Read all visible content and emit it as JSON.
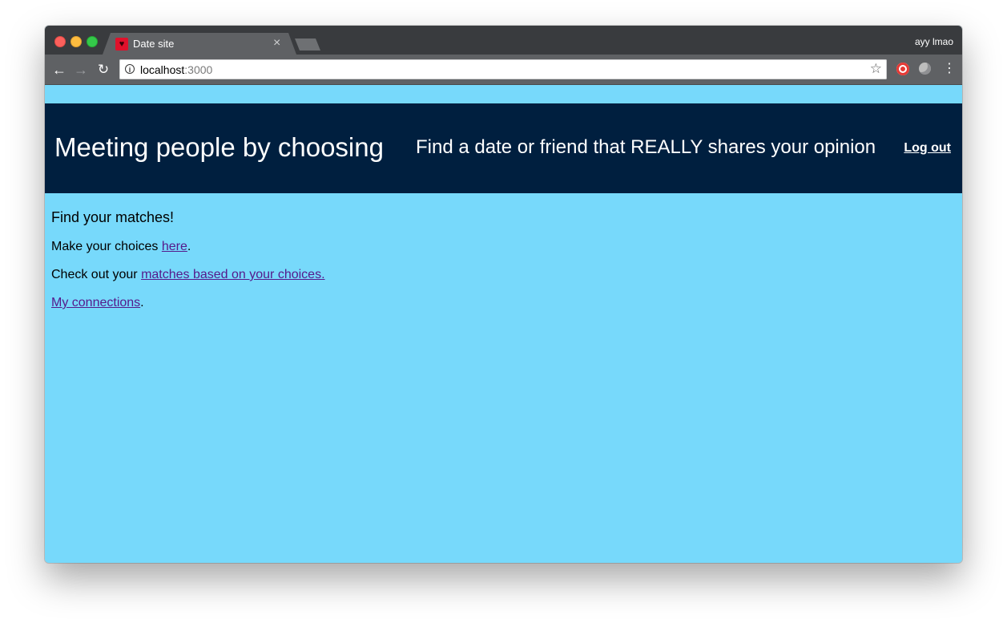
{
  "browser": {
    "tab_title": "Date site",
    "tab_close": "×",
    "profile_name": "ayy lmao",
    "url_host": "localhost",
    "url_port": ":3000",
    "icons": {
      "back": "←",
      "forward": "→",
      "reload": "↻",
      "info": "i",
      "star": "☆",
      "menu": "⋮",
      "favicon": "♥"
    }
  },
  "header": {
    "title": "Meeting people by choosing",
    "tagline": "Find a date or friend that REALLY shares your opinion",
    "logout_label": "Log out"
  },
  "main": {
    "heading": "Find your matches!",
    "choices_prefix": "Make your choices ",
    "choices_link": "here",
    "choices_suffix": ".",
    "matches_prefix": "Check out your ",
    "matches_link": "matches based on your choices.",
    "connections_link": "My connections",
    "connections_suffix": "."
  },
  "colors": {
    "page_background": "#77d9fb",
    "header_background": "#001f3f",
    "link": "#551a8b"
  }
}
